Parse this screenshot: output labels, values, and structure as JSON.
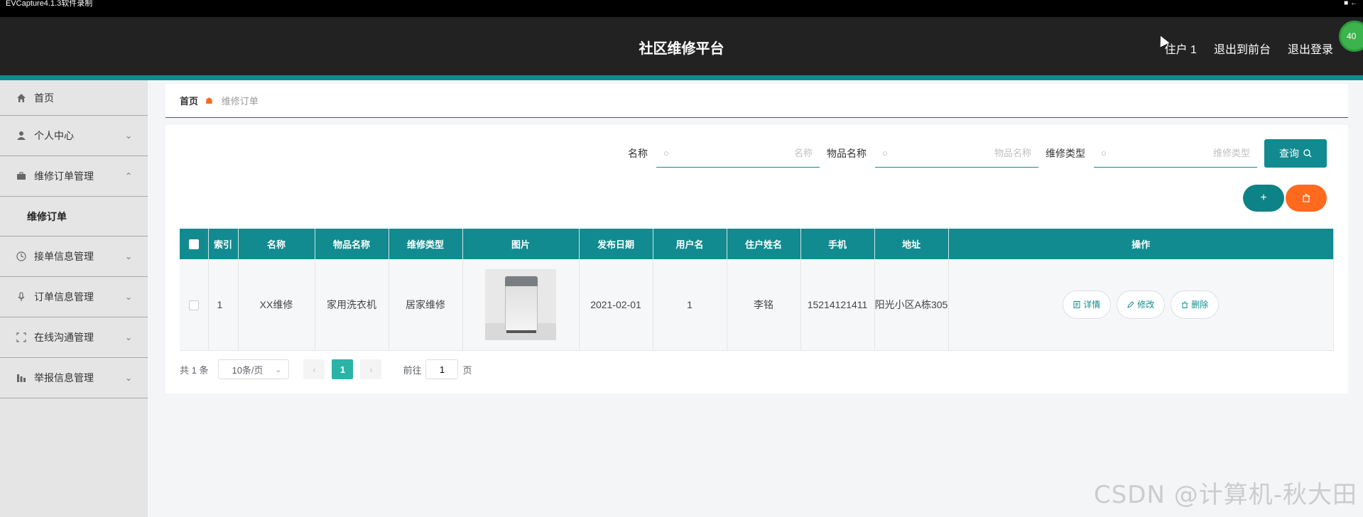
{
  "recorder": {
    "title": "EVCapture4.1.3软件录制"
  },
  "header": {
    "title": "社区维修平台",
    "user": "住户 1",
    "front_link": "退出到前台",
    "logout_link": "退出登录",
    "badge": "40"
  },
  "sidebar": {
    "items": [
      {
        "label": "首页",
        "icon": "home-icon"
      },
      {
        "label": "个人中心",
        "icon": "user-icon"
      },
      {
        "label": "维修订单管理",
        "icon": "briefcase-icon"
      },
      {
        "label": "接单信息管理",
        "icon": "clock-icon"
      },
      {
        "label": "订单信息管理",
        "icon": "mic-icon"
      },
      {
        "label": "在线沟通管理",
        "icon": "frame-icon"
      },
      {
        "label": "举报信息管理",
        "icon": "bar-chart-icon"
      }
    ],
    "subitem": "维修订单"
  },
  "breadcrumb": {
    "home": "首页",
    "current": "维修订单"
  },
  "search": {
    "name_label": "名称",
    "name_placeholder": "名称",
    "item_label": "物品名称",
    "item_placeholder": "物品名称",
    "type_label": "维修类型",
    "type_placeholder": "维修类型",
    "query_button": "查询"
  },
  "actions": {
    "add": "+",
    "delete": "🗑"
  },
  "table": {
    "headers": [
      "索引",
      "名称",
      "物品名称",
      "维修类型",
      "图片",
      "发布日期",
      "用户名",
      "住户姓名",
      "手机",
      "地址",
      "操作"
    ],
    "rows": [
      {
        "index": "1",
        "name": "XX维修",
        "item": "家用洗衣机",
        "type": "居家维修",
        "image": "washing-machine-photo",
        "date": "2021-02-01",
        "username": "1",
        "resident": "李铭",
        "phone": "15214121411",
        "address": "阳光小区A栋305"
      }
    ],
    "ops": {
      "detail": "详情",
      "edit": "修改",
      "delete": "删除"
    }
  },
  "pagination": {
    "total": "共 1 条",
    "page_size": "10条/页",
    "current_page": "1",
    "goto_prefix": "前往",
    "goto_value": "1",
    "goto_suffix": "页"
  },
  "watermark": "CSDN @计算机-秋大田",
  "colors": {
    "topbar": "#222222",
    "accent": "#118b8f",
    "danger": "#ff6a1f"
  }
}
